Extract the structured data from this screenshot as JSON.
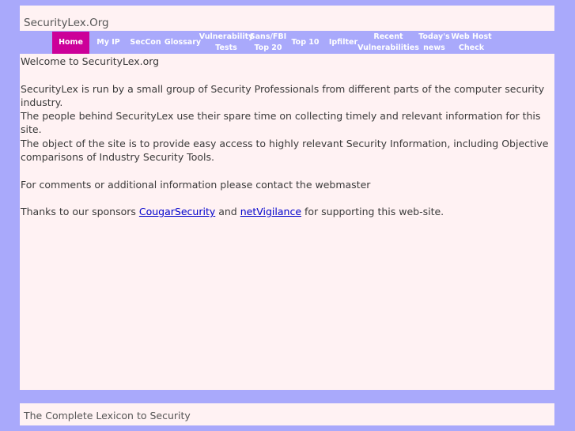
{
  "header": {
    "title": "SecurityLex.Org"
  },
  "nav": {
    "items": [
      {
        "label": "Home"
      },
      {
        "label": "My IP"
      },
      {
        "label": "SecCon"
      },
      {
        "label": "Glossary"
      },
      {
        "line1": "Vulnerability",
        "line2": "Tests"
      },
      {
        "line1": "Sans/FBI",
        "line2": "Top 20"
      },
      {
        "label": "Top 10"
      },
      {
        "label": "Ipfilter"
      },
      {
        "line1": "Recent",
        "line2": "Vulnerabilities"
      },
      {
        "line1": "Today's",
        "line2": "news"
      },
      {
        "line1": "Web Host",
        "line2": "Check"
      }
    ]
  },
  "content": {
    "welcome": "Welcome to SecurityLex.org",
    "p1": "SecurityLex is run by a small group of Security Professionals from different parts of the computer security industry.",
    "p2": "The people behind SecurityLex use their spare time on collecting timely and relevant information for this site.",
    "p3": "The object of the site is to provide easy access to highly relevant Security Information, including Objective comparisons of Industry Security Tools.",
    "p4": "For comments or additional information please contact the webmaster",
    "p5_before": "Thanks to our sponsors ",
    "sponsor1": "CougarSecurity",
    "p5_mid": " and ",
    "sponsor2": "netVigilance",
    "p5_after": " for supporting this web-site."
  },
  "footer": {
    "text": "The Complete Lexicon to Security"
  },
  "colors": {
    "page_bg": "#a9a9fb",
    "panel_bg": "#fff2f3",
    "nav_active": "#cc0099",
    "link": "#0000cc"
  }
}
